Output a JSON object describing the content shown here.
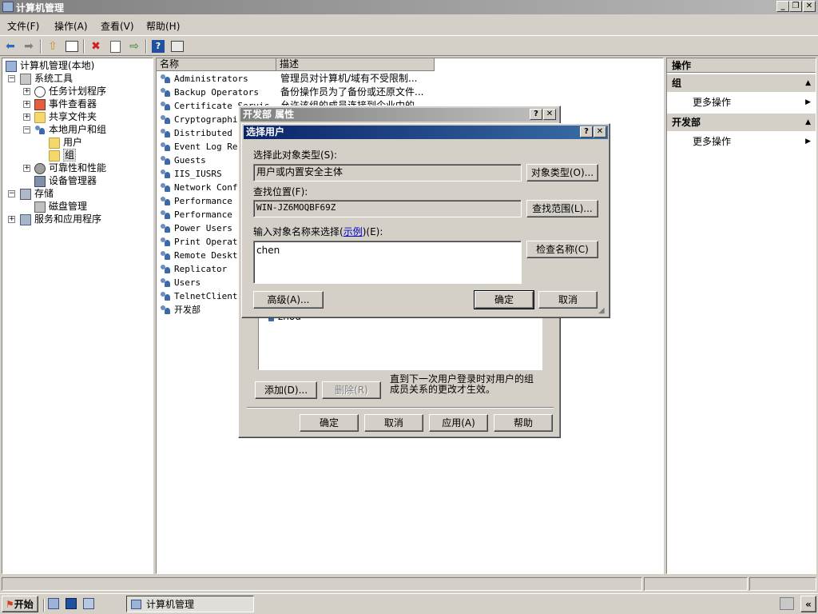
{
  "window": {
    "title": "计算机管理"
  },
  "menu": [
    "文件(F)",
    "操作(A)",
    "查看(V)",
    "帮助(H)"
  ],
  "toolbar": [
    "back-icon",
    "forward-icon",
    "up-folder-icon",
    "show-tree-icon",
    "delete-icon",
    "properties-icon",
    "export-icon",
    "help-icon",
    "console-icon"
  ],
  "tree": {
    "root": "计算机管理(本地)",
    "system_tools": "系统工具",
    "task_scheduler": "任务计划程序",
    "event_viewer": "事件查看器",
    "shared_folders": "共享文件夹",
    "local_users": "本地用户和组",
    "users": "用户",
    "groups": "组",
    "reliability": "可靠性和性能",
    "device_manager": "设备管理器",
    "storage": "存储",
    "disk_mgmt": "磁盘管理",
    "services": "服务和应用程序"
  },
  "list": {
    "col_name": "名称",
    "col_desc": "描述",
    "rows": [
      {
        "name": "Administrators",
        "desc": "管理员对计算机/域有不受限制..."
      },
      {
        "name": "Backup Operators",
        "desc": "备份操作员为了备份或还原文件..."
      },
      {
        "name": "Certificate Servic",
        "desc": "允许该组的成员连接到企业中的..."
      },
      {
        "name": "Cryptographic",
        "desc": ""
      },
      {
        "name": "Distributed CO",
        "desc": ""
      },
      {
        "name": "Event Log Read",
        "desc": ""
      },
      {
        "name": "Guests",
        "desc": ""
      },
      {
        "name": "IIS_IUSRS",
        "desc": ""
      },
      {
        "name": "Network Config",
        "desc": ""
      },
      {
        "name": "Performance Lo",
        "desc": ""
      },
      {
        "name": "Performance Mo",
        "desc": ""
      },
      {
        "name": "Power Users",
        "desc": ""
      },
      {
        "name": "Print Operator",
        "desc": ""
      },
      {
        "name": "Remote Desktop",
        "desc": ""
      },
      {
        "name": "Replicator",
        "desc": ""
      },
      {
        "name": "Users",
        "desc": ""
      },
      {
        "name": "TelnetClients",
        "desc": ""
      },
      {
        "name": "开发部",
        "desc": ""
      }
    ]
  },
  "actions": {
    "header": "操作",
    "group_section": "组",
    "more1": "更多操作",
    "dev_section": "开发部",
    "more2": "更多操作"
  },
  "props_dialog": {
    "title": "开发部 属性",
    "member": "zhou",
    "add": "添加(D)...",
    "remove": "删除(R)",
    "note": "直到下一次用户登录时对用户的组成员关系的更改才生效。",
    "ok": "确定",
    "cancel": "取消",
    "apply": "应用(A)",
    "help": "帮助"
  },
  "select_dialog": {
    "title": "选择用户",
    "obj_type_label": "选择此对象类型(S):",
    "obj_type_value": "用户或内置安全主体",
    "obj_type_btn": "对象类型(O)...",
    "location_label": "查找位置(F):",
    "location_value": "WIN-JZ6MOQBF69Z",
    "location_btn": "查找范围(L)...",
    "enter_label_pre": "输入对象名称来选择(",
    "example_link": "示例",
    "enter_label_post": ")(E):",
    "names_value": "chen",
    "check_btn": "检查名称(C)",
    "advanced_btn": "高级(A)...",
    "ok": "确定",
    "cancel": "取消"
  },
  "taskbar": {
    "start": "开始",
    "task": "计算机管理"
  }
}
